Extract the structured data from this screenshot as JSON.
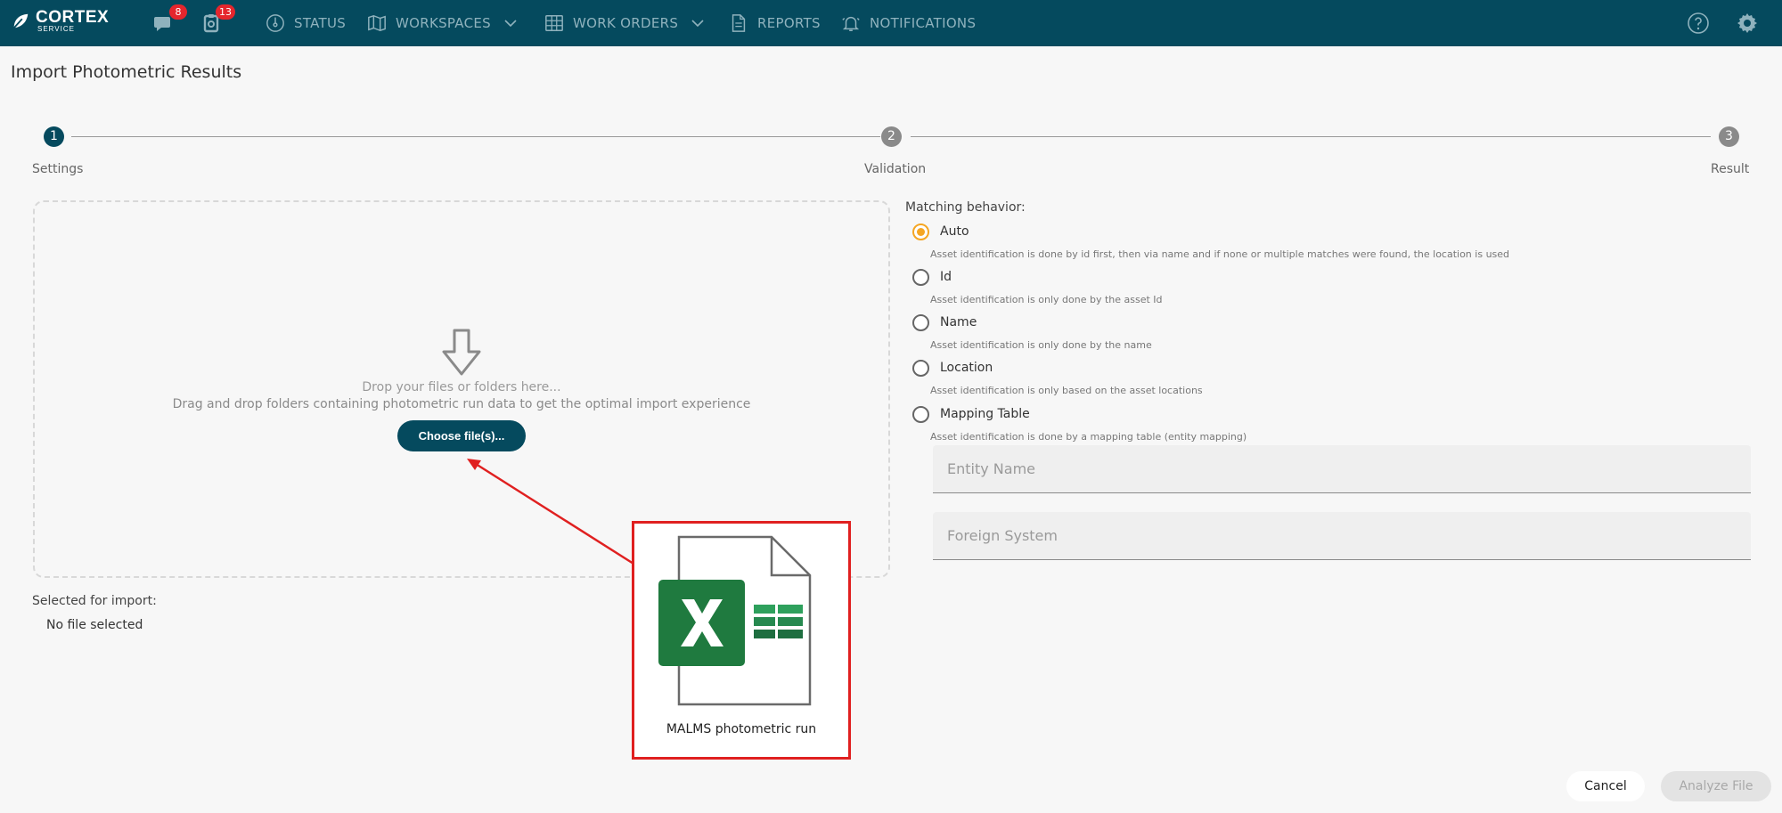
{
  "app": {
    "logo_main": "CORTEX",
    "logo_sub": "SERVICE"
  },
  "header": {
    "chat_badge": "8",
    "tasks_badge": "13",
    "nav": [
      {
        "label": "STATUS",
        "icon": "gauge-icon"
      },
      {
        "label": "WORKSPACES",
        "icon": "map-icon"
      },
      {
        "label": "WORK ORDERS",
        "icon": "grid-icon"
      },
      {
        "label": "REPORTS",
        "icon": "document-icon"
      },
      {
        "label": "NOTIFICATIONS",
        "icon": "bell-icon"
      }
    ]
  },
  "page": {
    "title": "Import Photometric Results"
  },
  "stepper": {
    "steps": [
      {
        "number": "1",
        "label": "Settings"
      },
      {
        "number": "2",
        "label": "Validation"
      },
      {
        "number": "3",
        "label": "Result"
      }
    ]
  },
  "dropzone": {
    "line1": "Drop your files or folders here...",
    "line2": "Drag and drop folders containing photometric run data to get the optimal import experience",
    "button": "Choose file(s)..."
  },
  "selection": {
    "label": "Selected for import:",
    "value": "No file selected"
  },
  "matching": {
    "title": "Matching behavior:",
    "options": [
      {
        "label": "Auto",
        "desc": "Asset identification is done by id first, then via name and if none or multiple matches were found, the location is used"
      },
      {
        "label": "Id",
        "desc": "Asset identification is only done by the asset Id"
      },
      {
        "label": "Name",
        "desc": "Asset identification is only done by the name"
      },
      {
        "label": "Location",
        "desc": "Asset identification is only based on the asset locations"
      },
      {
        "label": "Mapping Table",
        "desc": "Asset identification is done by a mapping table (entity mapping)"
      }
    ],
    "selected": "Auto",
    "entity_name_placeholder": "Entity Name",
    "foreign_system_placeholder": "Foreign System"
  },
  "callout": {
    "caption": "MALMS photometric run"
  },
  "footer": {
    "cancel": "Cancel",
    "analyze": "Analyze File"
  },
  "colors": {
    "header": "#054a5e",
    "accent": "#f5a623",
    "callout_border": "#e02020",
    "excel_green": "#1f7a3f"
  }
}
